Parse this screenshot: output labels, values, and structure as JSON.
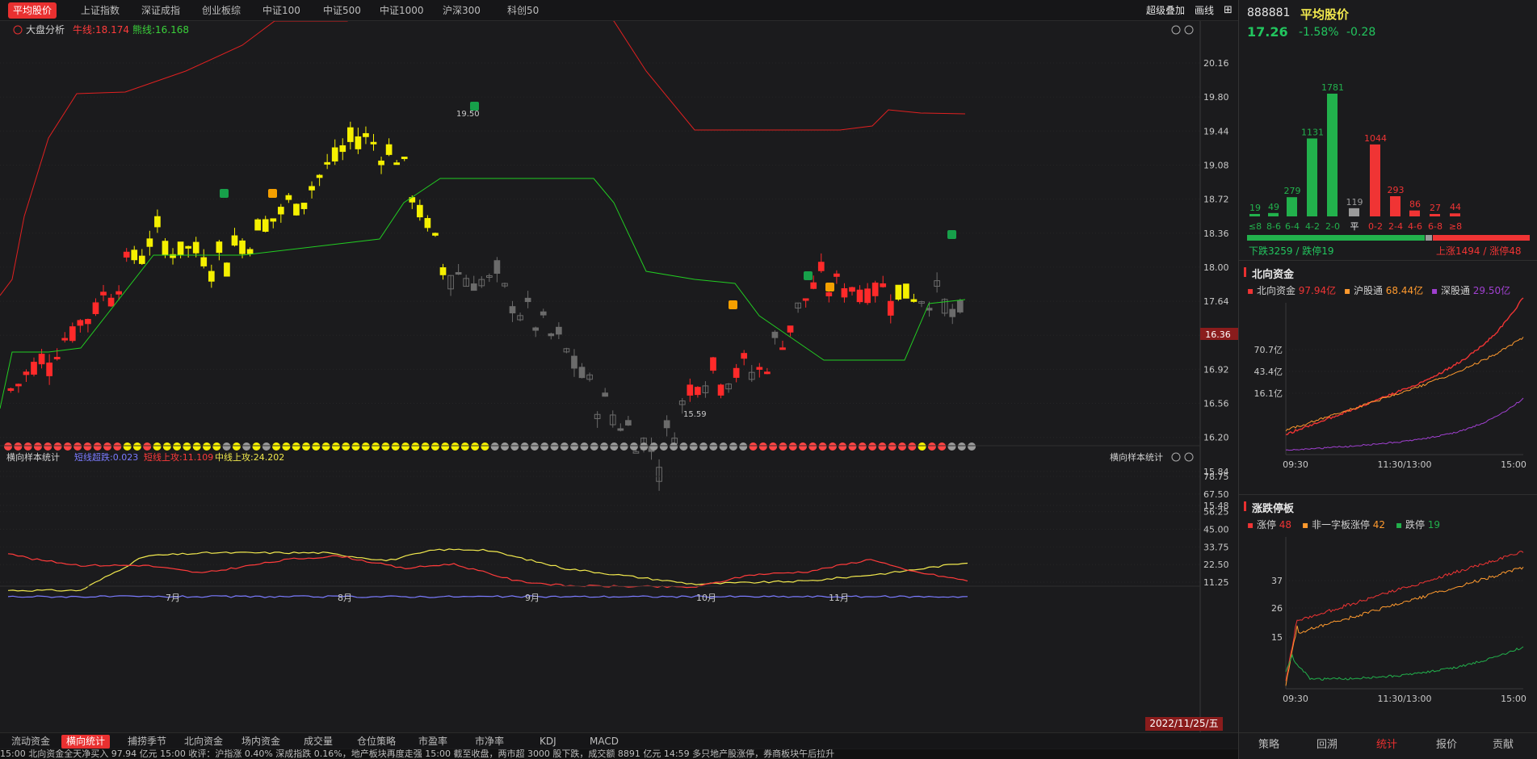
{
  "top_tabs": [
    "平均股价",
    "上证指数",
    "深证成指",
    "创业板综",
    "中证100",
    "中证500",
    "中证1000",
    "沪深300",
    "科创50"
  ],
  "top_tab_active": 0,
  "top_right": {
    "overlay": "超级叠加",
    "draw": "画线"
  },
  "main_chart": {
    "indicator_name": "大盘分析",
    "bull_label": "牛线:18.174",
    "bear_label": "熊线:16.168",
    "y_ticks": [
      "20.16",
      "19.80",
      "19.44",
      "19.08",
      "18.72",
      "18.36",
      "18.00",
      "17.64",
      "17.28",
      "16.92",
      "16.56",
      "16.20",
      "15.84",
      "15.48"
    ],
    "current_price_tag": "16.36",
    "high_label": "19.50",
    "low_label": "15.59"
  },
  "sub_chart": {
    "title": "横向样本统计",
    "right_title": "横向样本统计",
    "legend": [
      {
        "text": "短线超跌:0.023",
        "color": "#7b7bff"
      },
      {
        "text": "短线上攻:11.109",
        "color": "#ff3b3b"
      },
      {
        "text": "中线上攻:24.202",
        "color": "#f2e94e"
      }
    ],
    "y_ticks": [
      "78.75",
      "67.50",
      "56.25",
      "45.00",
      "33.75",
      "22.50",
      "11.25"
    ]
  },
  "x_axis_labels": [
    "7月",
    "8月",
    "9月",
    "10月",
    "11月"
  ],
  "date_badge": "2022/11/25/五",
  "bottom_tabs": [
    "流动资金",
    "横向统计",
    "捕捞季节",
    "北向资金",
    "场内资金",
    "成交量",
    "仓位策略",
    "市盈率",
    "市净率",
    "KDJ",
    "MACD"
  ],
  "bottom_tab_active": 1,
  "ticker_text": "15:00 北向资金全天净买入 97.94 亿元    15:00 收评：沪指涨 0.40% 深成指跌 0.16%，地产板块再度走强    15:00 截至收盘，两市超 3000 股下跌，成交额 8891 亿元    14:59 多只地产股涨停，券商板块午后拉升",
  "right": {
    "code": "888881",
    "name": "平均股价",
    "price": "17.26",
    "pct": "-1.58%",
    "chg": "-0.28",
    "colors": {
      "up": "#f03434",
      "down": "#22b14c",
      "flat": "#9a9a9a"
    },
    "dist": {
      "labels": [
        "≤8",
        "8-6",
        "6-4",
        "4-2",
        "2-0",
        "平",
        "0-2",
        "2-4",
        "4-6",
        "6-8",
        "≥8"
      ],
      "values": [
        19,
        49,
        279,
        1131,
        1781,
        119,
        1044,
        293,
        86,
        27,
        44
      ]
    },
    "down_text": "下跌3259 / 跌停19",
    "up_text": "上涨1494 / 涨停48",
    "north": {
      "title": "北向资金",
      "legend": [
        {
          "label": "北向资金",
          "value": "97.94亿",
          "color": "#f03434"
        },
        {
          "label": "沪股通",
          "value": "68.44亿",
          "color": "#ff9a2e"
        },
        {
          "label": "深股通",
          "value": "29.50亿",
          "color": "#a040d0"
        }
      ],
      "y_ticks": [
        "70.7亿",
        "43.4亿",
        "16.1亿"
      ],
      "x_ticks": [
        "09:30",
        "11:30/13:00",
        "15:00"
      ]
    },
    "limit": {
      "title": "涨跌停板",
      "legend": [
        {
          "label": "涨停",
          "value": "48",
          "color": "#f03434"
        },
        {
          "label": "非一字板涨停",
          "value": "42",
          "color": "#ff9a2e"
        },
        {
          "label": "跌停",
          "value": "19",
          "color": "#22b14c"
        }
      ],
      "y_ticks": [
        "37",
        "26",
        "15"
      ],
      "x_ticks": [
        "09:30",
        "11:30/13:00",
        "15:00"
      ]
    },
    "bottom_tabs": [
      "策略",
      "回溯",
      "统计",
      "报价",
      "贡献"
    ],
    "bottom_active": 2
  }
}
